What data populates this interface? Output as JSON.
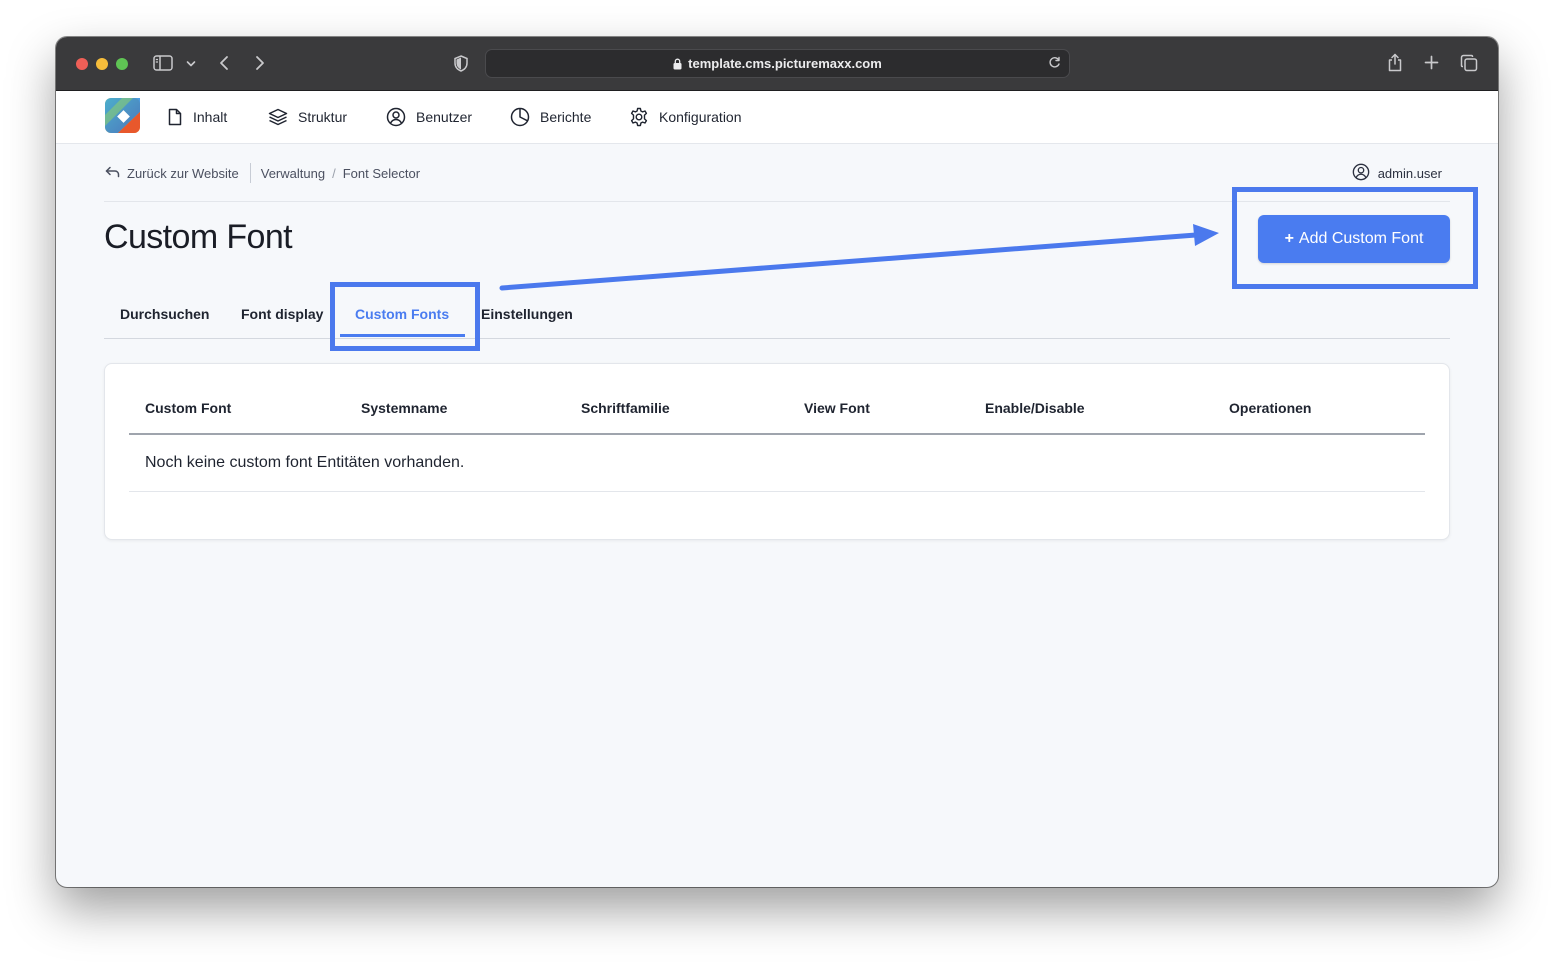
{
  "browser": {
    "url": "template.cms.picturemaxx.com",
    "icons": [
      "sidebar-icon",
      "chevron-down-icon",
      "back-arrow-icon",
      "forward-arrow-icon",
      "shield-icon",
      "lock-icon",
      "reload-icon",
      "share-icon",
      "new-tab-icon",
      "tabs-overview-icon"
    ]
  },
  "nav": {
    "items": [
      {
        "label": "Inhalt",
        "icon": "document-icon"
      },
      {
        "label": "Struktur",
        "icon": "layers-icon"
      },
      {
        "label": "Benutzer",
        "icon": "user-circle-icon"
      },
      {
        "label": "Berichte",
        "icon": "pie-chart-icon"
      },
      {
        "label": "Konfiguration",
        "icon": "gear-icon"
      }
    ]
  },
  "breadcrumb": {
    "back_label": "Zurück zur Website",
    "items": [
      "Verwaltung",
      "Font Selector"
    ],
    "separator": "/"
  },
  "user": {
    "name": "admin.user"
  },
  "page": {
    "title": "Custom Font",
    "add_button_label": "Add Custom Font",
    "add_button_prefix": "+"
  },
  "tabs": [
    {
      "label": "Durchsuchen",
      "active": false
    },
    {
      "label": "Font display",
      "active": false
    },
    {
      "label": "Custom Fonts",
      "active": true
    },
    {
      "label": "Einstellungen",
      "active": false
    }
  ],
  "table": {
    "columns": [
      "Custom Font",
      "Systemname",
      "Schriftfamilie",
      "View Font",
      "Enable/Disable",
      "Operationen"
    ],
    "empty_message": "Noch keine custom font Entitäten vorhanden."
  },
  "colors": {
    "accent": "#4a7cf0",
    "annotation": "#4b79ed",
    "titlebar": "#3a3a3c"
  }
}
